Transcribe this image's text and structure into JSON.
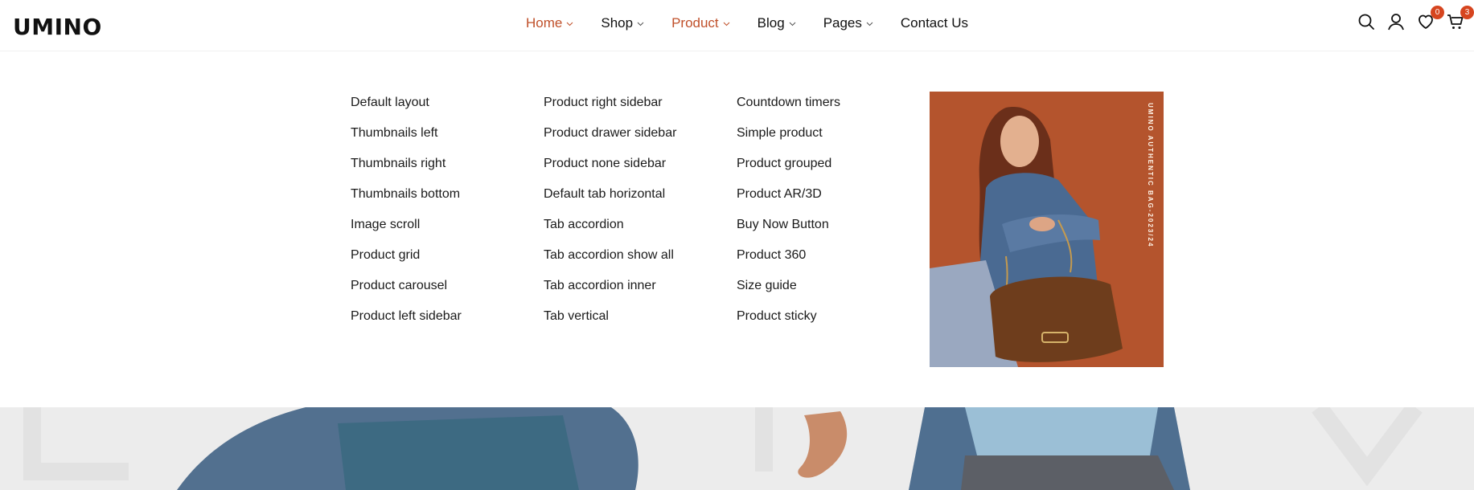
{
  "brand": {
    "logo_text": "UMINO"
  },
  "nav": {
    "items": [
      {
        "label": "Home",
        "has_dropdown": true,
        "active": true
      },
      {
        "label": "Shop",
        "has_dropdown": true,
        "active": false
      },
      {
        "label": "Product",
        "has_dropdown": true,
        "active": true
      },
      {
        "label": "Blog",
        "has_dropdown": true,
        "active": false
      },
      {
        "label": "Pages",
        "has_dropdown": true,
        "active": false
      },
      {
        "label": "Contact Us",
        "has_dropdown": false,
        "active": false
      }
    ]
  },
  "header_icons": {
    "search": "search-icon",
    "account": "user-icon",
    "wishlist": {
      "icon": "heart-icon",
      "count": "0"
    },
    "cart": {
      "icon": "cart-icon",
      "count": "3"
    }
  },
  "mega_menu": {
    "columns": [
      [
        "Default layout",
        "Thumbnails left",
        "Thumbnails right",
        "Thumbnails bottom",
        "Image scroll",
        "Product grid",
        "Product carousel",
        "Product left sidebar"
      ],
      [
        "Product right sidebar",
        "Product drawer sidebar",
        "Product none sidebar",
        "Default tab horizontal",
        "Tab accordion",
        "Tab accordion show all",
        "Tab accordion inner",
        "Tab vertical"
      ],
      [
        "Countdown timers",
        "Simple product",
        "Product grouped",
        "Product AR/3D",
        "Buy Now Button",
        "Product 360",
        "Size guide",
        "Product sticky"
      ]
    ],
    "promo_caption": "UMINO AUTHENTIC BAG-2023/24"
  },
  "colors": {
    "accent": "#c0502a",
    "badge": "#d6451f",
    "promo_bg": "#b4542d"
  }
}
